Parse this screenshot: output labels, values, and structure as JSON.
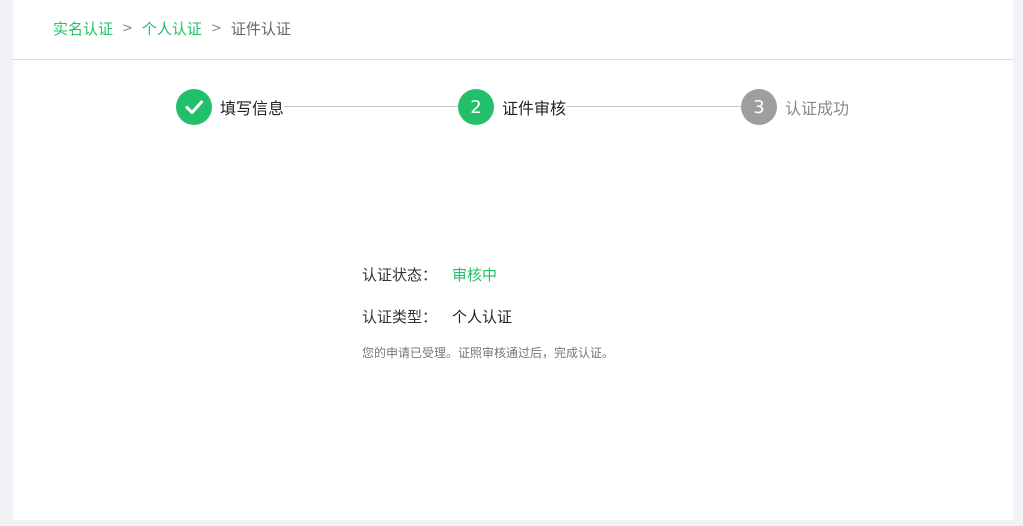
{
  "breadcrumb": {
    "items": [
      "实名认证",
      "个人认证",
      "证件认证"
    ],
    "separator": ">"
  },
  "steps": [
    {
      "label": "填写信息",
      "status": "done",
      "icon": "check-icon"
    },
    {
      "label": "证件审核",
      "status": "current",
      "number": "2"
    },
    {
      "label": "认证成功",
      "status": "pending",
      "number": "3"
    }
  ],
  "info": {
    "status_label": "认证状态：",
    "status_value": "审核中",
    "type_label": "认证类型：",
    "type_value": "个人认证",
    "note": "您的申请已受理。证照审核通过后，完成认证。"
  },
  "colors": {
    "accent": "#22c06b",
    "pending": "#9e9e9e"
  }
}
